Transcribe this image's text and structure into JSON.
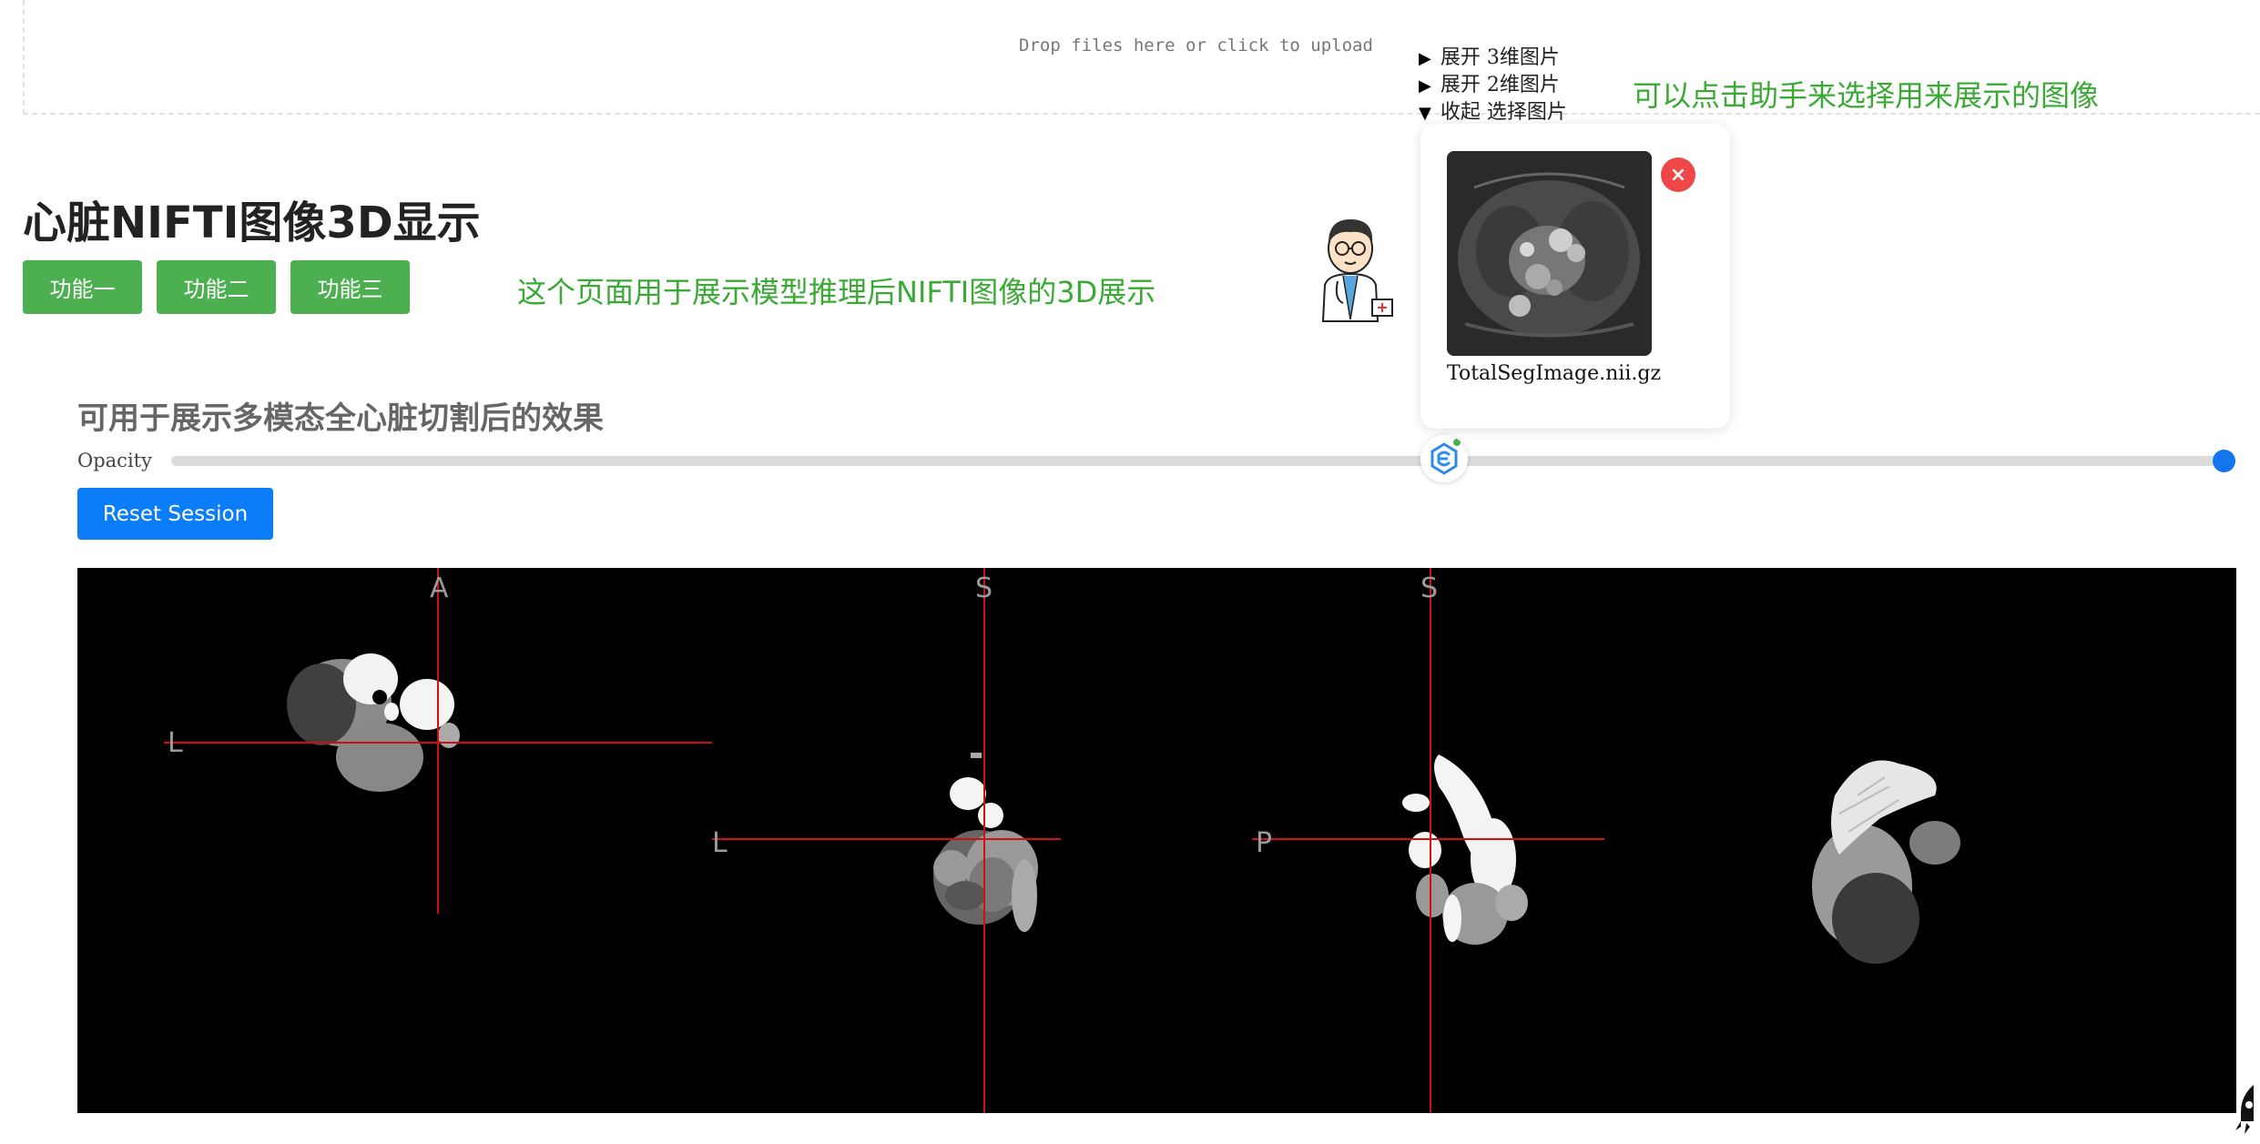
{
  "upload": {
    "text": "Drop files here or click to upload"
  },
  "page_title": "心脏NIFTI图像3D显示",
  "buttons": {
    "func1": "功能一",
    "func2": "功能二",
    "func3": "功能三"
  },
  "notes": {
    "page_desc": "这个页面用于展示模型推理后NIFTI图像的3D展示",
    "assistant_hint": "可以点击助手来选择用来展示的图像"
  },
  "collapse": {
    "items": [
      {
        "arrow": "▶",
        "label": "展开 3维图片"
      },
      {
        "arrow": "▶",
        "label": "展开 2维图片"
      },
      {
        "arrow": "▼",
        "label": "收起 选择图片"
      }
    ]
  },
  "popup": {
    "image_label": "TotalSegImage.nii.gz",
    "close": "×"
  },
  "viewer_section": {
    "subtitle": "可用于展示多模态全心脏切割后的效果",
    "opacity_label": "Opacity",
    "opacity_value": 1.0,
    "reset_label": "Reset Session"
  },
  "orientation_labels": {
    "axial_top": "A",
    "axial_left": "L",
    "coronal_top": "S",
    "coronal_left": "L",
    "sagittal_top": "S",
    "sagittal_left": "P"
  },
  "colors": {
    "green_button": "#4caf50",
    "note_green": "#3aaa35",
    "blue_button": "#0b7df8",
    "slider_thumb": "#1476ee",
    "close_red": "#ef4747",
    "crosshair": "#d01010"
  }
}
